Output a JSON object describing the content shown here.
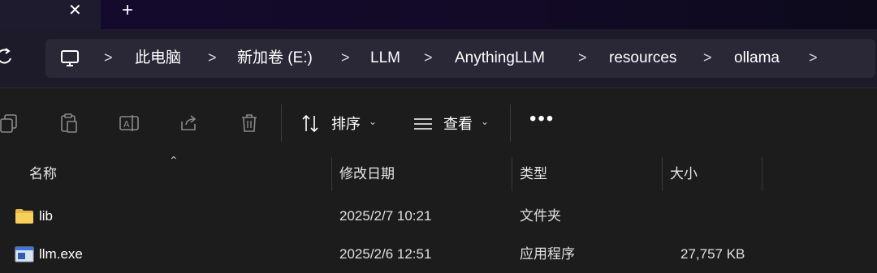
{
  "titlebar": {
    "close_glyph": "✕",
    "new_tab_glyph": "+"
  },
  "breadcrumb": {
    "items": [
      "此电脑",
      "新加卷 (E:)",
      "LLM",
      "AnythingLLM",
      "resources",
      "ollama"
    ],
    "separator": ">"
  },
  "toolbar": {
    "sort_label": "排序",
    "view_label": "查看",
    "more_glyph": "•••"
  },
  "columns": {
    "name": "名称",
    "modified": "修改日期",
    "type": "类型",
    "size": "大小"
  },
  "files": [
    {
      "name": "lib",
      "modified": "2025/2/7 10:21",
      "type": "文件夹",
      "size": "",
      "icon": "folder-icon"
    },
    {
      "name": "llm.exe",
      "modified": "2025/2/6 12:51",
      "type": "应用程序",
      "size": "27,757 KB",
      "icon": "exe-icon"
    }
  ],
  "colors": {
    "background": "#1c1c1c",
    "titlebar": "#150a2e",
    "addressbar": "#2a2736",
    "folder": "#f2c94c"
  }
}
